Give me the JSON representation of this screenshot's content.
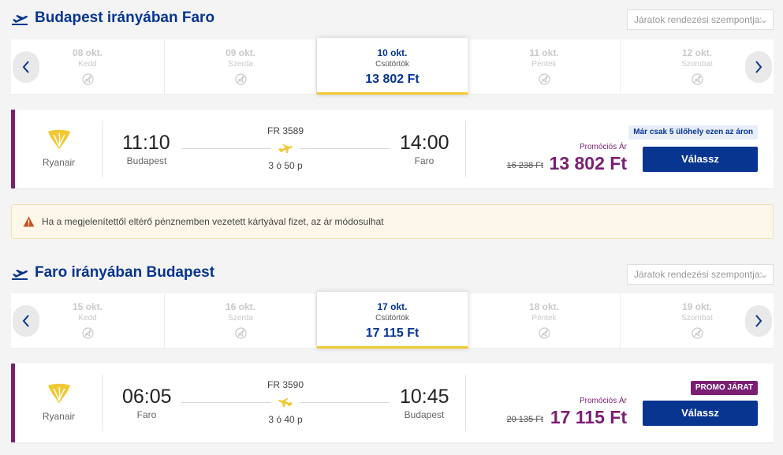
{
  "colors": {
    "primary": "#073590",
    "accent": "#f1c933",
    "promo": "#7a1f74",
    "warning_icon": "#c7541f"
  },
  "outbound": {
    "title": "Budapest irányában Faro",
    "sort_placeholder": "Járatok rendezési szempontja:",
    "dates": [
      {
        "date": "08 okt.",
        "day": "Kedd",
        "available": false
      },
      {
        "date": "09 okt.",
        "day": "Szerda",
        "available": false
      },
      {
        "date": "10 okt.",
        "day": "Csütörtök",
        "price": "13 802 Ft",
        "selected": true
      },
      {
        "date": "11 okt.",
        "day": "Péntek",
        "available": false
      },
      {
        "date": "12 okt.",
        "day": "Szombat",
        "available": false
      }
    ],
    "flight": {
      "airline": "Ryanair",
      "flight_number": "FR 3589",
      "depart_time": "11:10",
      "depart_city": "Budapest",
      "arrive_time": "14:00",
      "arrive_city": "Faro",
      "duration": "3 ó 50 p",
      "badge": "Már csak 5 ülőhely ezen az áron",
      "promo_label": "Promóciós Ár",
      "old_price": "16 238 Ft",
      "price": "13 802 Ft",
      "select_label": "Válassz"
    }
  },
  "notice": {
    "text": "Ha a megjelenítettől eltérő pénznemben vezetett kártyával fizet, az ár módosulhat",
    "icon": "warning-icon"
  },
  "inbound": {
    "title": "Faro irányában Budapest",
    "sort_placeholder": "Járatok rendezési szempontja:",
    "dates": [
      {
        "date": "15 okt.",
        "day": "Kedd",
        "available": false
      },
      {
        "date": "16 okt.",
        "day": "Szerda",
        "available": false
      },
      {
        "date": "17 okt.",
        "day": "Csütörtök",
        "price": "17 115 Ft",
        "selected": true
      },
      {
        "date": "18 okt.",
        "day": "Péntek",
        "available": false
      },
      {
        "date": "19 okt.",
        "day": "Szombat",
        "available": false
      }
    ],
    "flight": {
      "airline": "Ryanair",
      "flight_number": "FR 3590",
      "depart_time": "06:05",
      "depart_city": "Faro",
      "arrive_time": "10:45",
      "arrive_city": "Budapest",
      "duration": "3 ó 40 p",
      "badge": "PROMO JÁRAT",
      "promo_label": "Promóciós Ár",
      "old_price": "20 135 Ft",
      "price": "17 115 Ft",
      "select_label": "Válassz"
    }
  }
}
